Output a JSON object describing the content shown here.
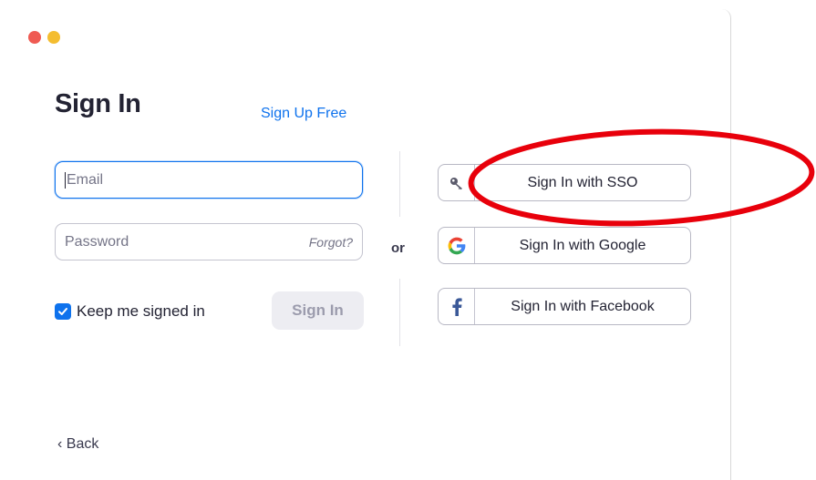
{
  "window": {
    "controls": [
      "close",
      "minimize"
    ],
    "colors": {
      "close": "#ef5a52",
      "minimize": "#f4bd30",
      "accent": "#0e72ed",
      "annotation": "#e8000b"
    }
  },
  "form": {
    "title": "Sign In",
    "signup_link": "Sign Up Free",
    "email": {
      "value": "",
      "placeholder": "Email"
    },
    "password": {
      "value": "",
      "placeholder": "Password",
      "forgot_label": "Forgot?"
    },
    "keep_signed_in": {
      "label": "Keep me signed in",
      "checked": true
    },
    "signin_button": "Sign In",
    "back_link": "Back"
  },
  "divider": {
    "label": "or"
  },
  "alt_signin": [
    {
      "label": "Sign In with SSO",
      "icon": "key-icon"
    },
    {
      "label": "Sign In with Google",
      "icon": "google-icon"
    },
    {
      "label": "Sign In with Facebook",
      "icon": "facebook-icon"
    }
  ],
  "annotation": {
    "type": "circle",
    "target": "Sign In with SSO",
    "color": "#e8000b"
  }
}
